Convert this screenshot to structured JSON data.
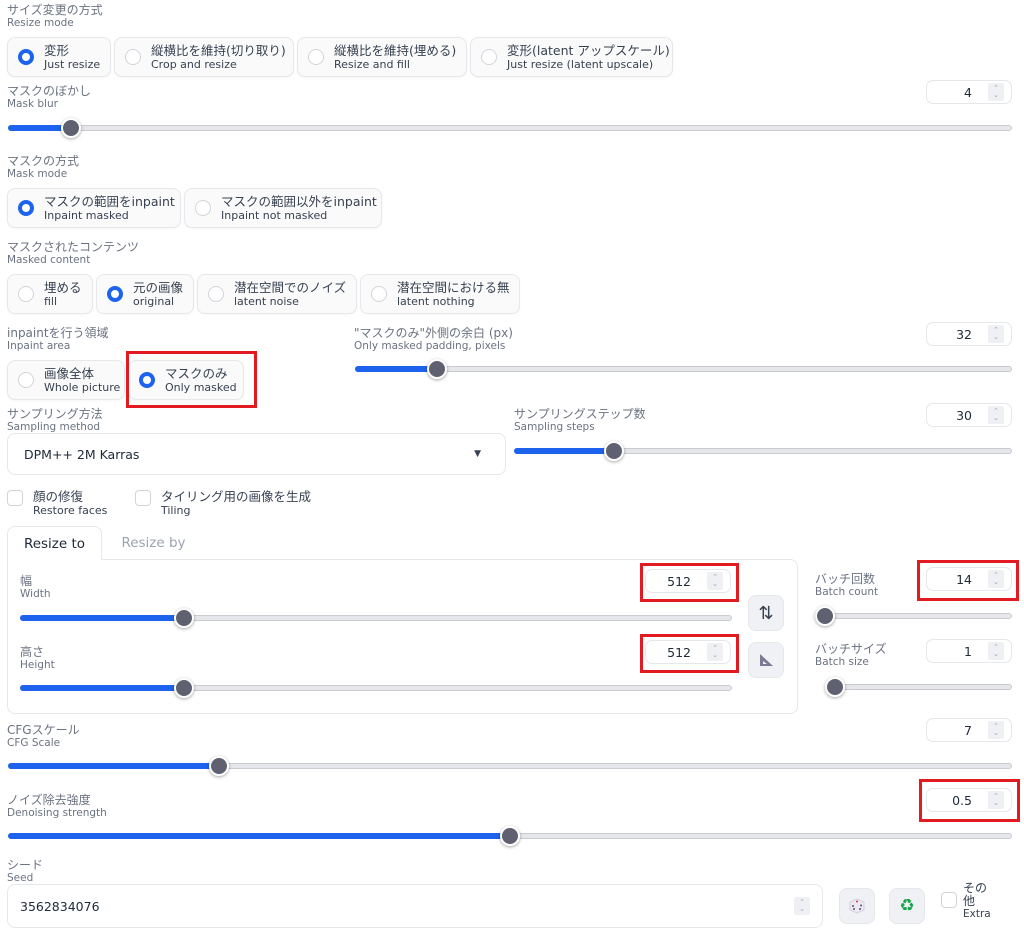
{
  "resize_mode": {
    "label_jp": "サイズ変更の方式",
    "label_en": "Resize mode",
    "options": [
      {
        "jp": "変形",
        "en": "Just resize",
        "checked": true
      },
      {
        "jp": "縦横比を維持(切り取り)",
        "en": "Crop and resize",
        "checked": false
      },
      {
        "jp": "縦横比を維持(埋める)",
        "en": "Resize and fill",
        "checked": false
      },
      {
        "jp": "変形(latent アップスケール)",
        "en": "Just resize (latent upscale)",
        "checked": false
      }
    ]
  },
  "mask_blur": {
    "label_jp": "マスクのぼかし",
    "label_en": "Mask blur",
    "value": "4",
    "fraction": 0.0625
  },
  "mask_mode": {
    "label_jp": "マスクの方式",
    "label_en": "Mask mode",
    "options": [
      {
        "jp": "マスクの範囲をinpaint",
        "en": "Inpaint masked",
        "checked": true
      },
      {
        "jp": "マスクの範囲以外をinpaint",
        "en": "Inpaint not masked",
        "checked": false
      }
    ]
  },
  "masked_content": {
    "label_jp": "マスクされたコンテンツ",
    "label_en": "Masked content",
    "options": [
      {
        "jp": "埋める",
        "en": "fill",
        "checked": false
      },
      {
        "jp": "元の画像",
        "en": "original",
        "checked": true
      },
      {
        "jp": "潜在空間でのノイズ",
        "en": "latent noise",
        "checked": false
      },
      {
        "jp": "潜在空間における無",
        "en": "latent nothing",
        "checked": false
      }
    ]
  },
  "inpaint_area": {
    "label_jp": "inpaintを行う領域",
    "label_en": "Inpaint area",
    "options": [
      {
        "jp": "画像全体",
        "en": "Whole picture",
        "checked": false
      },
      {
        "jp": "マスクのみ",
        "en": "Only masked",
        "checked": true
      }
    ]
  },
  "padding": {
    "label_jp": "\"マスクのみ\"外側の余白 (px)",
    "label_en": "Only masked padding, pixels",
    "value": "32",
    "fraction": 0.125
  },
  "sampling_method": {
    "label_jp": "サンプリング方法",
    "label_en": "Sampling method",
    "value": "DPM++ 2M Karras"
  },
  "sampling_steps": {
    "label_jp": "サンプリングステップ数",
    "label_en": "Sampling steps",
    "value": "30",
    "fraction": 0.2
  },
  "restore_faces": {
    "jp": "顔の修復",
    "en": "Restore faces",
    "checked": false
  },
  "tiling": {
    "jp": "タイリング用の画像を生成",
    "en": "Tiling",
    "checked": false
  },
  "tabs": [
    {
      "label": "Resize to",
      "active": true
    },
    {
      "label": "Resize by",
      "active": false
    }
  ],
  "width": {
    "label_jp": "幅",
    "label_en": "Width",
    "value": "512",
    "fraction": 0.23
  },
  "height": {
    "label_jp": "高さ",
    "label_en": "Height",
    "value": "512",
    "fraction": 0.23
  },
  "swap_icon": "⇅",
  "batch_count": {
    "label_jp": "バッチ回数",
    "label_en": "Batch count",
    "value": "14",
    "fraction": 0.01
  },
  "batch_size": {
    "label_jp": "バッチサイズ",
    "label_en": "Batch size",
    "value": "1",
    "fraction": 0.0
  },
  "cfg_scale": {
    "label_jp": "CFGスケール",
    "label_en": "CFG Scale",
    "value": "7",
    "fraction": 0.21
  },
  "denoising": {
    "label_jp": "ノイズ除去強度",
    "label_en": "Denoising strength",
    "value": "0.5",
    "fraction": 0.5
  },
  "seed": {
    "label_jp": "シード",
    "label_en": "Seed",
    "value": "3562834076"
  },
  "extra": {
    "jp": "その他",
    "en": "Extra",
    "checked": false
  },
  "colors": {
    "accent": "#1d63ed",
    "highlight": "#e21b23",
    "thumb": "#5f6070",
    "recycle": "#16a34a"
  }
}
